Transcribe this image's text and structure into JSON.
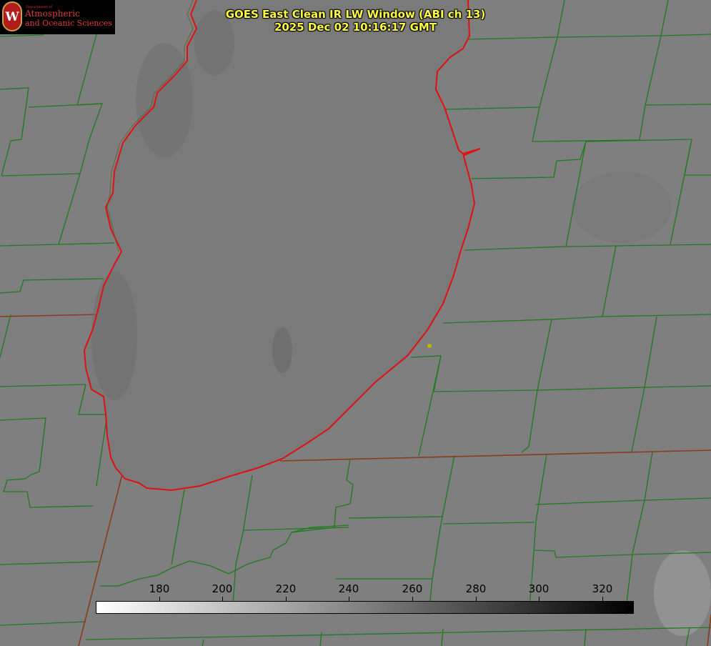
{
  "logo": {
    "seal_letter": "W",
    "department": "Department of",
    "name_line1": "Atmospheric",
    "name_line2": "and Oceanic Sciences"
  },
  "title": {
    "line1": "GOES East Clean IR LW Window (ABI ch 13)",
    "line2": "2025 Dec 02 10:16:17 GMT"
  },
  "colorbar": {
    "min": 160,
    "max": 330,
    "tick_values": [
      180,
      200,
      220,
      240,
      260,
      280,
      300,
      320
    ],
    "tick_labels": [
      "180",
      "200",
      "220",
      "240",
      "260",
      "280",
      "300",
      "320"
    ],
    "scale": "white-to-black (inverted grayscale)"
  },
  "map": {
    "feature": "Lake Michigan",
    "county_line_color": "#1f7a1f",
    "state_line_color": "#8b3a1a",
    "shoreline_color": "#e01010",
    "marker_color": "#c8b400",
    "background_gray": "#7f7f7f",
    "lake_gray": "#777777"
  }
}
